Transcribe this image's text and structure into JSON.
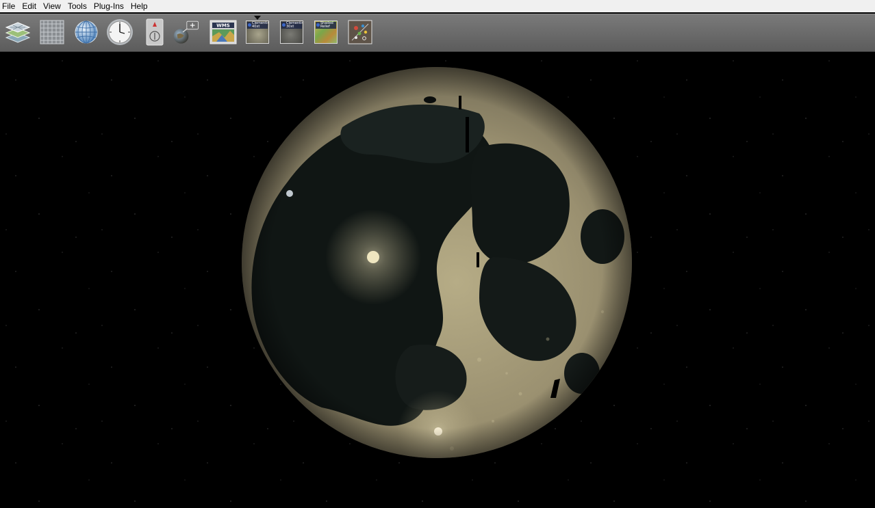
{
  "menu": [
    "File",
    "Edit",
    "View",
    "Tools",
    "Plug-Ins",
    "Help"
  ],
  "toolbar": {
    "tools": [
      {
        "id": "layers",
        "icon": "layers-icon"
      },
      {
        "id": "graticule",
        "icon": "graticule-icon"
      },
      {
        "id": "globe",
        "icon": "globe-icon"
      },
      {
        "id": "clock",
        "icon": "clock-icon"
      },
      {
        "id": "compass",
        "icon": "compass-icon"
      },
      {
        "id": "add-globe",
        "icon": "add-globe-icon"
      },
      {
        "id": "wms",
        "icon": "wms-icon",
        "label": "WMS"
      },
      {
        "id": "clementine-40xt",
        "icon": "moon-thumbnail-icon",
        "label": "Clementin 40xt",
        "selected": true
      },
      {
        "id": "clementine-30xt",
        "icon": "moon-thumbnail-icon",
        "label": "Clementin 30xt"
      },
      {
        "id": "shaded-relief",
        "icon": "shaded-relief-icon",
        "label": "Shaded Relief"
      },
      {
        "id": "tool-settings",
        "icon": "tool-settings-icon"
      }
    ]
  },
  "colors": {
    "toolbar_bg": "#6a6a6a",
    "menubar_bg": "#f0f0f0",
    "space_bg": "#000000",
    "moon_highland": "#a49a78",
    "moon_mare": "#121816"
  }
}
